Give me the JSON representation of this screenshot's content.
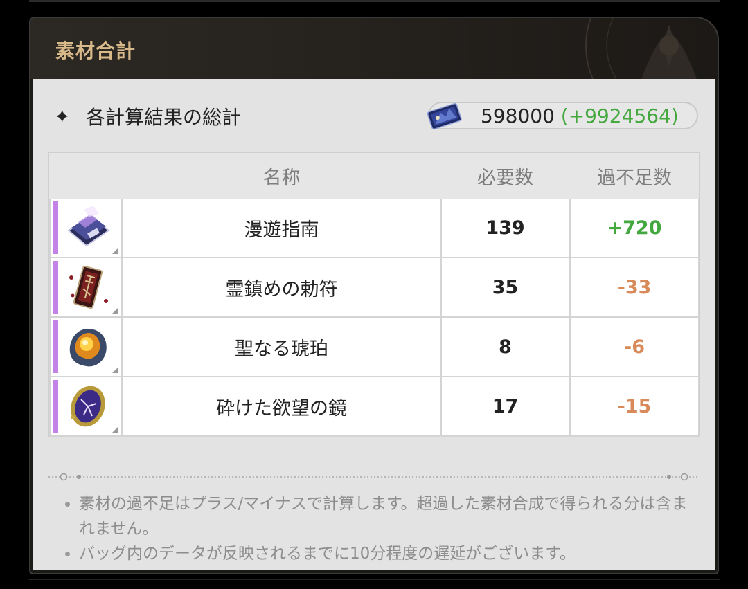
{
  "panel": {
    "title": "素材合計"
  },
  "summary": {
    "star_glyph": "✦",
    "title": "各計算結果の総計",
    "currency": {
      "icon": "card-ticket-icon",
      "amount": "598000",
      "surplus": "(+9924564)"
    }
  },
  "table": {
    "headers": {
      "name": "名称",
      "required": "必要数",
      "diff": "過不足数"
    },
    "rows": [
      {
        "icon": "travel-guide-book-icon",
        "name": "漫遊指南",
        "required": "139",
        "diff": "+720",
        "status": "surplus"
      },
      {
        "icon": "spirit-talisman-icon",
        "name": "霊鎮めの勅符",
        "required": "35",
        "diff": "-33",
        "status": "shortage"
      },
      {
        "icon": "holy-amber-icon",
        "name": "聖なる琥珀",
        "required": "8",
        "diff": "-6",
        "status": "shortage"
      },
      {
        "icon": "broken-mirror-icon",
        "name": "砕けた欲望の鏡",
        "required": "17",
        "diff": "-15",
        "status": "shortage"
      }
    ]
  },
  "notes": [
    "素材の過不足はプラス/マイナスで計算します。超過した素材合成で得られる分は含まれません。",
    "バッグ内のデータが反映されるまでに10分程度の遅延がございます。"
  ],
  "colors": {
    "title_gold": "#d8b98a",
    "surplus_green": "#43a83f",
    "shortage_orange": "#d98a5b",
    "rarity_purple": "#c382e6"
  }
}
